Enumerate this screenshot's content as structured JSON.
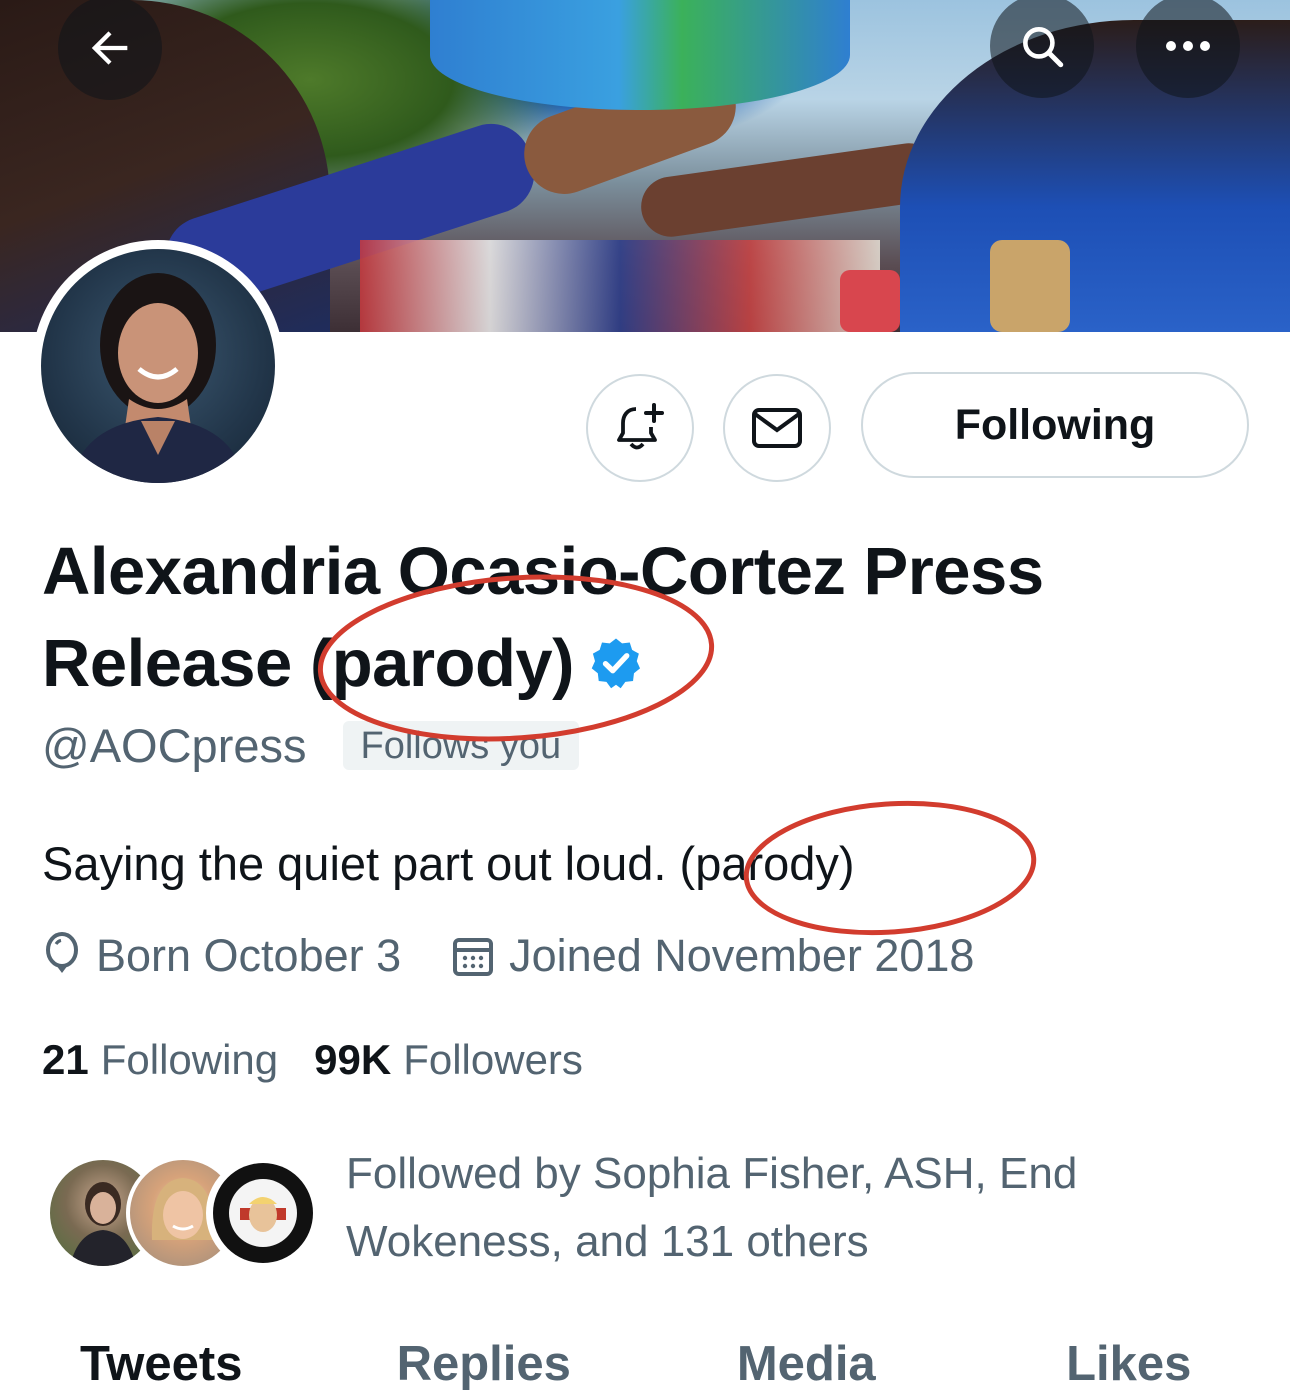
{
  "header": {
    "back_icon": "arrow-left-icon",
    "search_icon": "search-icon",
    "more_icon": "more-horizontal-icon"
  },
  "profile": {
    "name_line1": "Alexandria Ocasio-Cortez Press",
    "name_line2_prefix": "Release ",
    "name_line2_parody": "(parody)",
    "verified_color": "#1d9bf0",
    "handle": "@AOCpress",
    "follows_you": "Follows you",
    "bio_prefix": "Saying the quiet part out lou",
    "bio_rest": "d. (parody)",
    "born": "Born October 3",
    "joined": "Joined November 2018",
    "following_count": "21",
    "following_label": "Following",
    "followers_count": "99K",
    "followers_label": "Followers"
  },
  "actions": {
    "notify_icon": "bell-plus-icon",
    "message_icon": "envelope-icon",
    "following_button": "Following"
  },
  "followed_by": {
    "text_line1": "Followed by Sophia Fisher, ASH, End",
    "text_line2": "Wokeness, and 131 others"
  },
  "tabs": [
    "Tweets",
    "Replies",
    "Media",
    "Likes"
  ],
  "annotation_color": "#d23c2e"
}
